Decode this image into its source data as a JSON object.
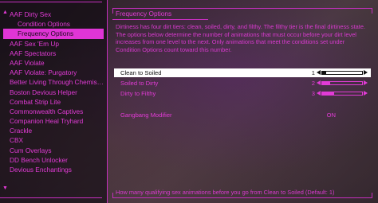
{
  "sidebar": {
    "items": [
      {
        "label": "AAF Dirty Sex",
        "sub": false,
        "selected": false
      },
      {
        "label": "Condition Options",
        "sub": true,
        "selected": false
      },
      {
        "label": "Frequency Options",
        "sub": true,
        "selected": true
      },
      {
        "label": "AAF Sex 'Em Up",
        "sub": false,
        "selected": false
      },
      {
        "label": "AAF Spectators",
        "sub": false,
        "selected": false
      },
      {
        "label": "AAF Violate",
        "sub": false,
        "selected": false
      },
      {
        "label": "AAF Violate: Purgatory",
        "sub": false,
        "selected": false
      },
      {
        "label": "Better Living Through Chemistry",
        "sub": false,
        "selected": false
      },
      {
        "label": "Boston Devious Helper",
        "sub": false,
        "selected": false
      },
      {
        "label": "Combat Strip Lite",
        "sub": false,
        "selected": false
      },
      {
        "label": "Commonwealth Captives",
        "sub": false,
        "selected": false
      },
      {
        "label": "Companion Heal Tryhard",
        "sub": false,
        "selected": false
      },
      {
        "label": "Crackle",
        "sub": false,
        "selected": false
      },
      {
        "label": "CBX",
        "sub": false,
        "selected": false
      },
      {
        "label": "Cum Overlays",
        "sub": false,
        "selected": false
      },
      {
        "label": "DD Bench Unlocker",
        "sub": false,
        "selected": false
      },
      {
        "label": "Devious Enchantings",
        "sub": false,
        "selected": false
      }
    ],
    "scroll_up_glyph": "▲",
    "scroll_down_glyph": "▼"
  },
  "panel": {
    "title": "Frequency Options",
    "description": "Dirtiness has four dirt tiers: clean, soiled, dirty, and filthy. The filthy tier is the final dirtiness state. The options below determine the number of animations that must occur before your dirt level increases from one level to the next. Only animations that meet the conditions set under Condition Options count toward this number.",
    "options": [
      {
        "label": "Clean to Soiled",
        "value": "1",
        "slider_fraction": 0.1,
        "selected": true
      },
      {
        "label": "Soiled to Dirty",
        "value": "2",
        "slider_fraction": 0.2,
        "selected": false
      },
      {
        "label": "Dirty to Filthy",
        "value": "3",
        "slider_fraction": 0.3,
        "selected": false
      }
    ],
    "toggle": {
      "label": "Gangbang Modifier",
      "value": "ON"
    },
    "hint": "How many qualifying sex animations before you go from Clean to Soiled (Default: 1)"
  },
  "colors": {
    "accent": "#e23bd6",
    "selected_bg": "#e035d6",
    "selected_row_bg": "#ffffff"
  }
}
